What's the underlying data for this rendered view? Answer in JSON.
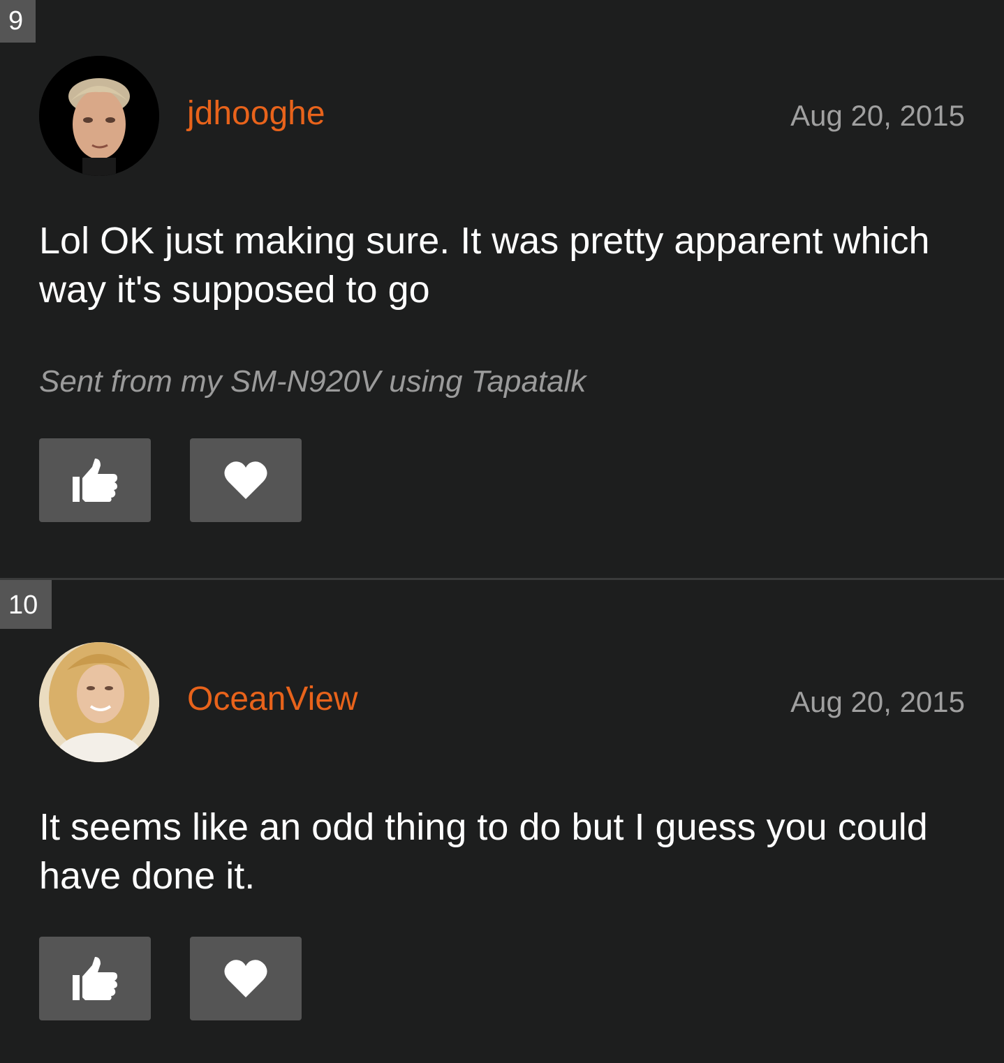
{
  "posts": [
    {
      "number": "9",
      "username": "jdhooghe",
      "date": "Aug 20, 2015",
      "body": "Lol OK just making sure. It was pretty apparent which way it's supposed to go",
      "signature": "Sent from my SM-N920V using Tapatalk",
      "avatar_icon": "user-photo-avatar",
      "actions": [
        {
          "icon": "thumbs-up-icon"
        },
        {
          "icon": "heart-icon"
        }
      ]
    },
    {
      "number": "10",
      "username": "OceanView",
      "date": "Aug 20, 2015",
      "body": "It seems like an odd thing to do but I guess you could have done it.",
      "avatar_icon": "user-photo-avatar",
      "actions": [
        {
          "icon": "thumbs-up-icon"
        },
        {
          "icon": "heart-icon"
        }
      ]
    }
  ],
  "colors": {
    "background": "#1d1e1e",
    "username": "#e8631b",
    "date": "#a0a0a0",
    "body_text": "#ffffff",
    "signature": "#9b9b9b",
    "button_bg": "#555555",
    "post_number_bg": "#555555"
  }
}
